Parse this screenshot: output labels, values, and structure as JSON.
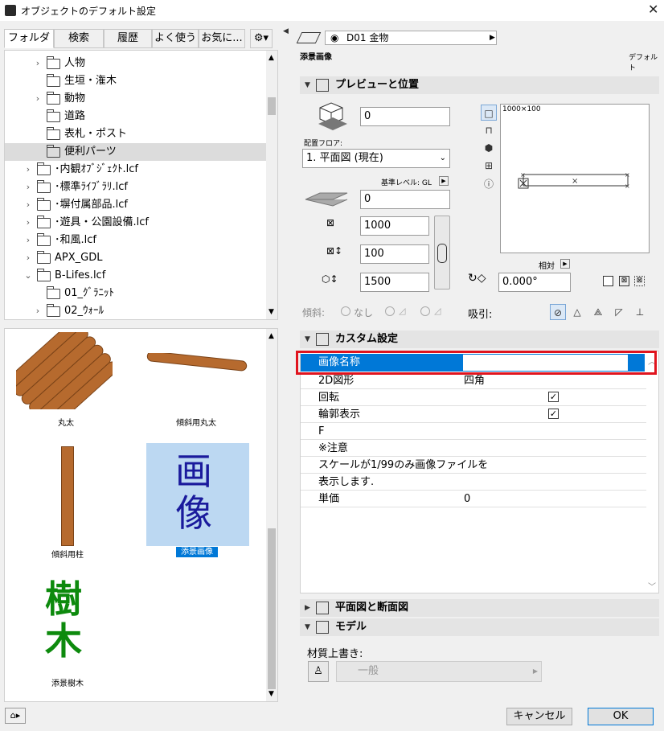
{
  "window": {
    "title": "オブジェクトのデフォルト設定",
    "close": "✕"
  },
  "tabs": [
    "フォルダ",
    "検索",
    "履歴",
    "よく使う",
    "お気に...",
    "⚙▾"
  ],
  "tree": [
    {
      "label": "人物",
      "arrow": "›"
    },
    {
      "label": "生垣・潅木",
      "arrow": ""
    },
    {
      "label": "動物",
      "arrow": "›"
    },
    {
      "label": "道路",
      "arrow": ""
    },
    {
      "label": "表札・ポスト",
      "arrow": ""
    },
    {
      "label": "便利パーツ",
      "arrow": ""
    },
    {
      "label": "･内観ｵﾌﾞｼﾞｪｸﾄ.lcf",
      "arrow": "›"
    },
    {
      "label": "･標準ﾗｲﾌﾞﾗﾘ.lcf",
      "arrow": "›"
    },
    {
      "label": "･塀付属部品.lcf",
      "arrow": "›"
    },
    {
      "label": "･遊具・公園設備.lcf",
      "arrow": "›"
    },
    {
      "label": "･和風.lcf",
      "arrow": "›"
    },
    {
      "label": "APX_GDL",
      "arrow": "›"
    },
    {
      "label": "B-Lifes.lcf",
      "arrow": "⌄"
    },
    {
      "label": "01_ｸﾞﾗﾆｯﾄ",
      "arrow": ""
    },
    {
      "label": "02_ｳｫｰﾙ",
      "arrow": "›"
    }
  ],
  "gallery": [
    {
      "caption": "丸太"
    },
    {
      "caption": "傾斜用丸太"
    },
    {
      "caption": "傾斜用柱"
    },
    {
      "caption": "添景画像",
      "glyph1": "画",
      "glyph2": "像"
    },
    {
      "caption": "添景樹木",
      "glyph1": "樹",
      "glyph2": "木"
    }
  ],
  "layer": {
    "value": "D01 金物"
  },
  "object_name": "添景画像",
  "default_label": "デフォルト",
  "sections": {
    "preview": "プレビューと位置",
    "custom": "カスタム設定",
    "floorplan": "平面図と断面図",
    "model": "モデル"
  },
  "preview_pos": {
    "offset": "0",
    "floor_label": "配置フロア:",
    "floor_value": "1. 平面図 (現在)",
    "ref_level": "基準レベル: GL",
    "elev": "0",
    "width": "1000",
    "depth": "100",
    "height": "1500",
    "slope_label": "傾斜:",
    "slope_none": "なし",
    "preview_caption": "1000×100",
    "relative": "相対",
    "angle": "0.000°",
    "snap_label": "吸引:"
  },
  "custom_rows": [
    {
      "key": "画像名称",
      "value": ""
    },
    {
      "key": "2D図形",
      "value": "四角"
    },
    {
      "key": "回転",
      "value": "",
      "check": "✓"
    },
    {
      "key": "輪郭表示",
      "value": "",
      "check": "✓"
    },
    {
      "key": "F",
      "value": ""
    },
    {
      "key": "※注意",
      "value": ""
    },
    {
      "key": "スケールが1/99のみ画像ファイルを",
      "value": ""
    },
    {
      "key": "表示します.",
      "value": ""
    },
    {
      "key": "単価",
      "value": "0"
    }
  ],
  "model": {
    "label": "材質上書き:",
    "material": "一般"
  },
  "buttons": {
    "cancel": "キャンセル",
    "ok": "OK"
  },
  "colors": {
    "accent": "#0078d7",
    "highlight": "#e0141e"
  }
}
